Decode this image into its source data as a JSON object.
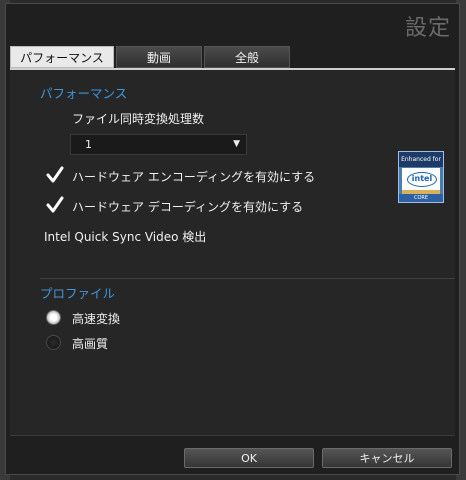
{
  "window": {
    "title": "設定"
  },
  "tabs": [
    {
      "label": "パフォーマンス",
      "active": true
    },
    {
      "label": "動画",
      "active": false
    },
    {
      "label": "全般",
      "active": false
    }
  ],
  "performance": {
    "section_title": "パフォーマンス",
    "concurrent_label": "ファイル同時変換処理数",
    "concurrent_value": "1",
    "hw_encode_label": "ハードウェア エンコーディングを有効にする",
    "hw_encode_checked": true,
    "hw_decode_label": "ハードウェア デコーディングを有効にする",
    "hw_decode_checked": true,
    "quicksync_label": "Intel Quick Sync Video 検出",
    "badge": {
      "top": "Enhanced for",
      "logo": "intel",
      "bottom": "CORE"
    }
  },
  "profile": {
    "section_title": "プロファイル",
    "options": [
      {
        "label": "高速変換",
        "selected": true
      },
      {
        "label": "高画質",
        "selected": false
      }
    ]
  },
  "buttons": {
    "ok": "OK",
    "cancel": "キャンセル"
  },
  "colors": {
    "accent": "#3e97dc",
    "background": "#1f1f1f"
  }
}
